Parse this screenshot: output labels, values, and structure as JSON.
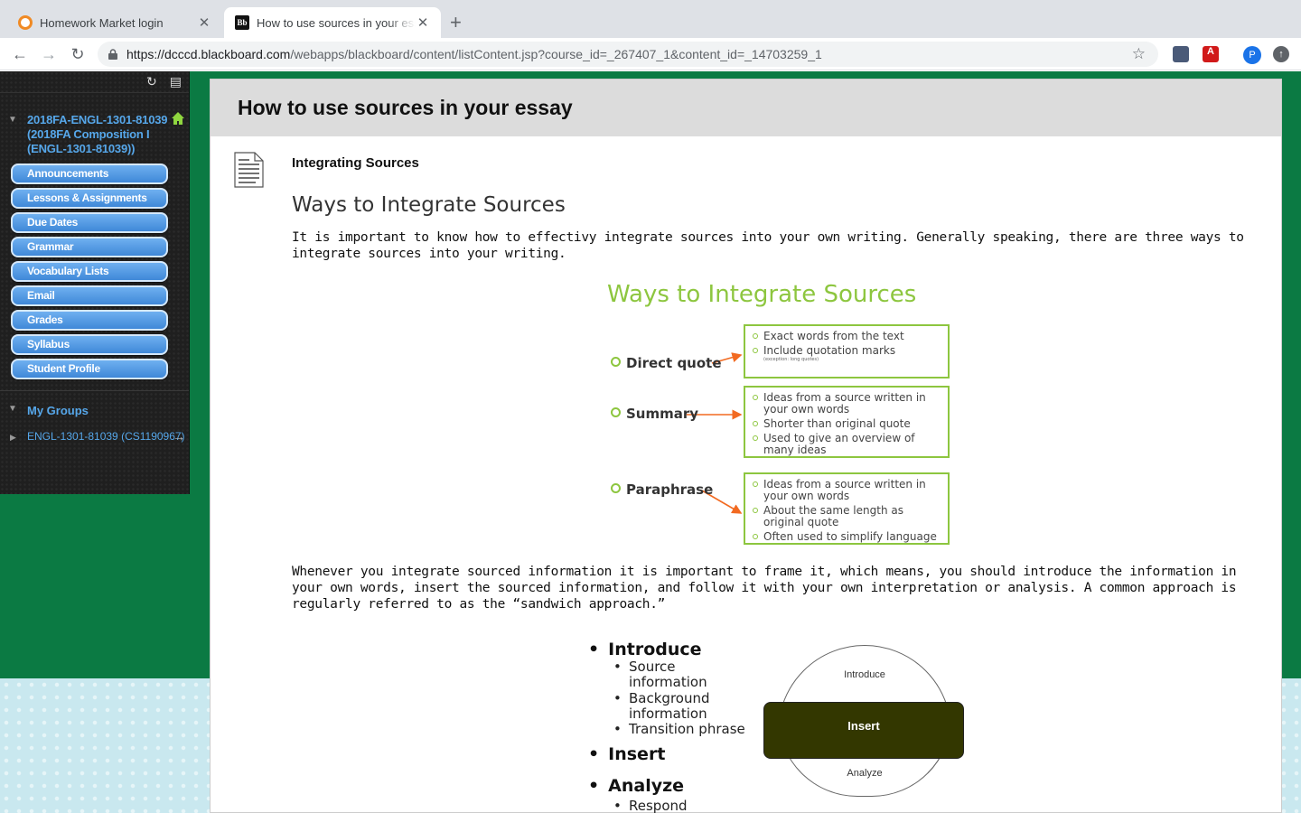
{
  "browser": {
    "tabs": [
      {
        "title": "Homework Market login",
        "active": false
      },
      {
        "title": "How to use sources in your essay",
        "active": true
      }
    ],
    "url_host": "https://dcccd.blackboard.com",
    "url_path": "/webapps/blackboard/content/listContent.jsp?course_id=_267407_1&content_id=_14703259_1",
    "profile_initial": "P"
  },
  "sidebar": {
    "course_title": "2018FA-ENGL-1301-81039 (2018FA Composition I (ENGL-1301-81039))",
    "menu": [
      "Announcements",
      "Lessons & Assignments",
      "Due Dates",
      "Grammar",
      "Vocabulary Lists",
      "Email",
      "Grades",
      "Syllabus",
      "Student Profile"
    ],
    "groups_title": "My Groups",
    "group_item": "ENGL-1301-81039 (CS1190967)"
  },
  "content": {
    "page_title": "How to use sources in your essay",
    "item_title": "Integrating Sources",
    "heading": "Ways to Integrate Sources",
    "para1": "It is important to know how to effectivy integrate sources into your own writing. Generally speaking, there are three ways to integrate sources into your writing.",
    "para2": "Whenever you integrate sourced information it is important to frame it, which means, you should introduce the information in your own words, insert the sourced information, and follow it with your own interpretation or analysis. A common approach is regularly referred to as the “sandwich approach.”"
  },
  "figure1": {
    "title": "Ways to Integrate Sources",
    "methods": [
      {
        "label": "Direct quote",
        "points": [
          "Exact words from the text",
          "Include quotation marks"
        ],
        "note": "(exception: long quotes)"
      },
      {
        "label": "Summary",
        "points": [
          "Ideas from a source written in your own words",
          "Shorter than original quote",
          "Used to give an overview of many ideas"
        ]
      },
      {
        "label": "Paraphrase",
        "points": [
          "Ideas from a source written in your own words",
          "About the same length as original quote",
          "Often used to simplify language"
        ]
      }
    ]
  },
  "figure2": {
    "introduce": "Introduce",
    "introduce_subs": [
      "Source information",
      "Background information",
      "Transition phrase"
    ],
    "insert": "Insert",
    "analyze": "Analyze",
    "analyze_sub": "Respond",
    "sandwich": {
      "top": "Introduce",
      "middle": "Insert",
      "bottom": "Analyze"
    }
  }
}
